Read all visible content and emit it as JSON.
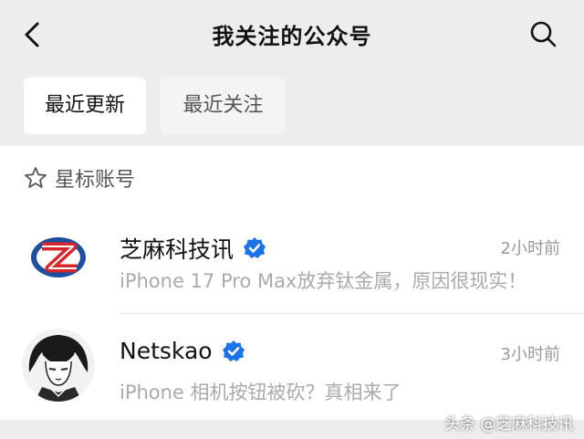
{
  "header": {
    "title": "我关注的公众号",
    "back_icon": "chevron-left-icon",
    "search_icon": "search-icon"
  },
  "tabs": [
    {
      "label": "最近更新",
      "active": true
    },
    {
      "label": "最近关注",
      "active": false
    }
  ],
  "section": {
    "label": "星标账号",
    "icon": "star-outline-icon"
  },
  "accounts": [
    {
      "name": "芝麻科技讯",
      "verified": true,
      "time": "2小时前",
      "latest": "iPhone 17 Pro Max放弃钛金属，原因很现实！",
      "avatar": "zhima-logo"
    },
    {
      "name": "Netskao",
      "verified": true,
      "time": "3小时前",
      "latest": "iPhone 相机按钮被砍？真相来了",
      "avatar": "anime-portrait"
    }
  ],
  "watermark": "头条 @芝麻科技讯",
  "colors": {
    "background": "#ededed",
    "verified_blue": "#1a73e8",
    "logo_red": "#d8262c",
    "logo_blue": "#1d4fa0"
  }
}
